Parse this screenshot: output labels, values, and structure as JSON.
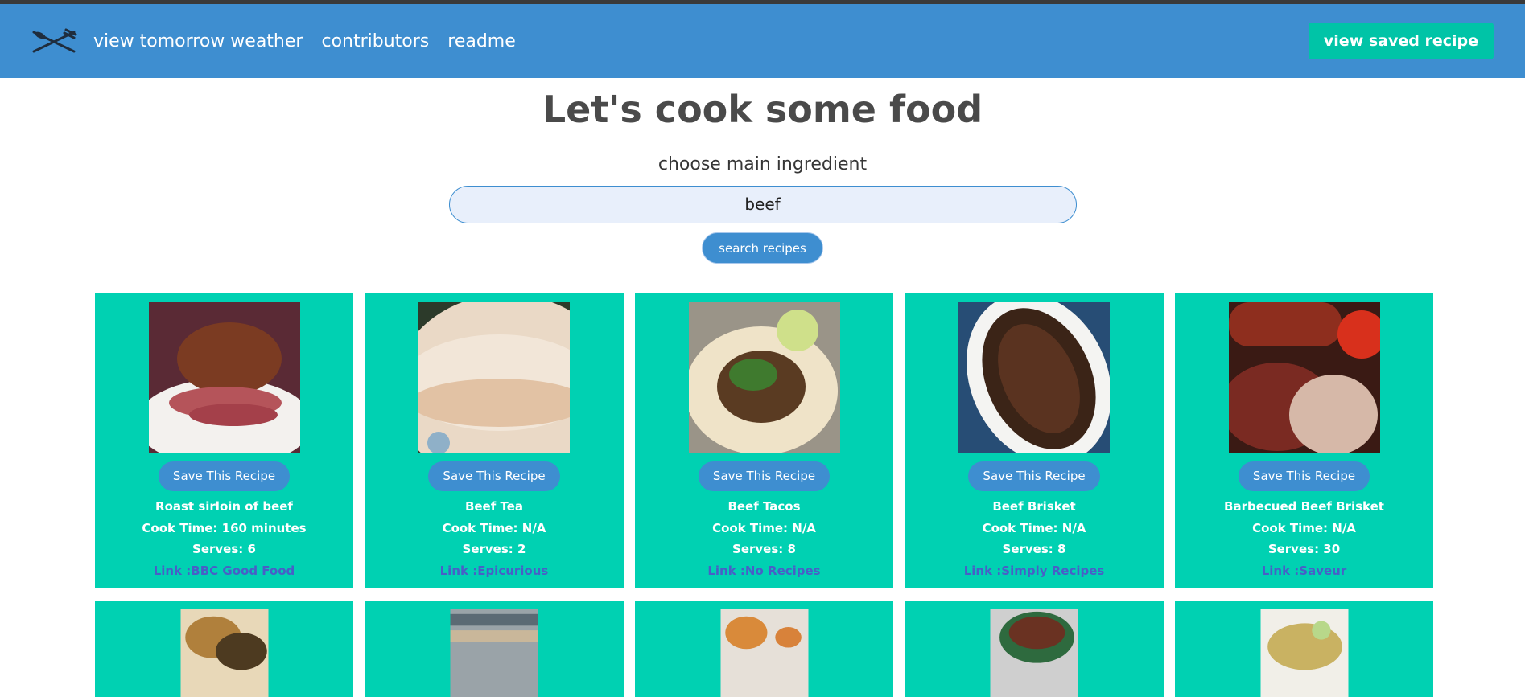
{
  "nav": {
    "logo_icon": "fork-knife-icon",
    "links": [
      "view tomorrow weather",
      "contributors",
      "readme"
    ],
    "saved_button": "view saved recipe"
  },
  "hero": {
    "title": "Let's cook some food",
    "subtitle": "choose main ingredient",
    "search_value": "beef",
    "search_button": "search recipes"
  },
  "recipes": [
    {
      "name": "Roast sirloin of beef",
      "cook_time": "Cook Time: 160 minutes",
      "serves": "Serves: 6",
      "link": "Link :BBC Good Food",
      "save": "Save This Recipe"
    },
    {
      "name": "Beef Tea",
      "cook_time": "Cook Time: N/A",
      "serves": "Serves: 2",
      "link": "Link :Epicurious",
      "save": "Save This Recipe"
    },
    {
      "name": "Beef Tacos",
      "cook_time": "Cook Time: N/A",
      "serves": "Serves: 8",
      "link": "Link :No Recipes",
      "save": "Save This Recipe"
    },
    {
      "name": "Beef Brisket",
      "cook_time": "Cook Time: N/A",
      "serves": "Serves: 8",
      "link": "Link :Simply Recipes",
      "save": "Save This Recipe"
    },
    {
      "name": "Barbecued Beef Brisket",
      "cook_time": "Cook Time: N/A",
      "serves": "Serves: 30",
      "link": "Link :Saveur",
      "save": "Save This Recipe"
    }
  ],
  "colors": {
    "navbar": "#3e8ed0",
    "card": "#00d1b2",
    "accent_button": "#00c4a7",
    "link": "#485fc7"
  }
}
